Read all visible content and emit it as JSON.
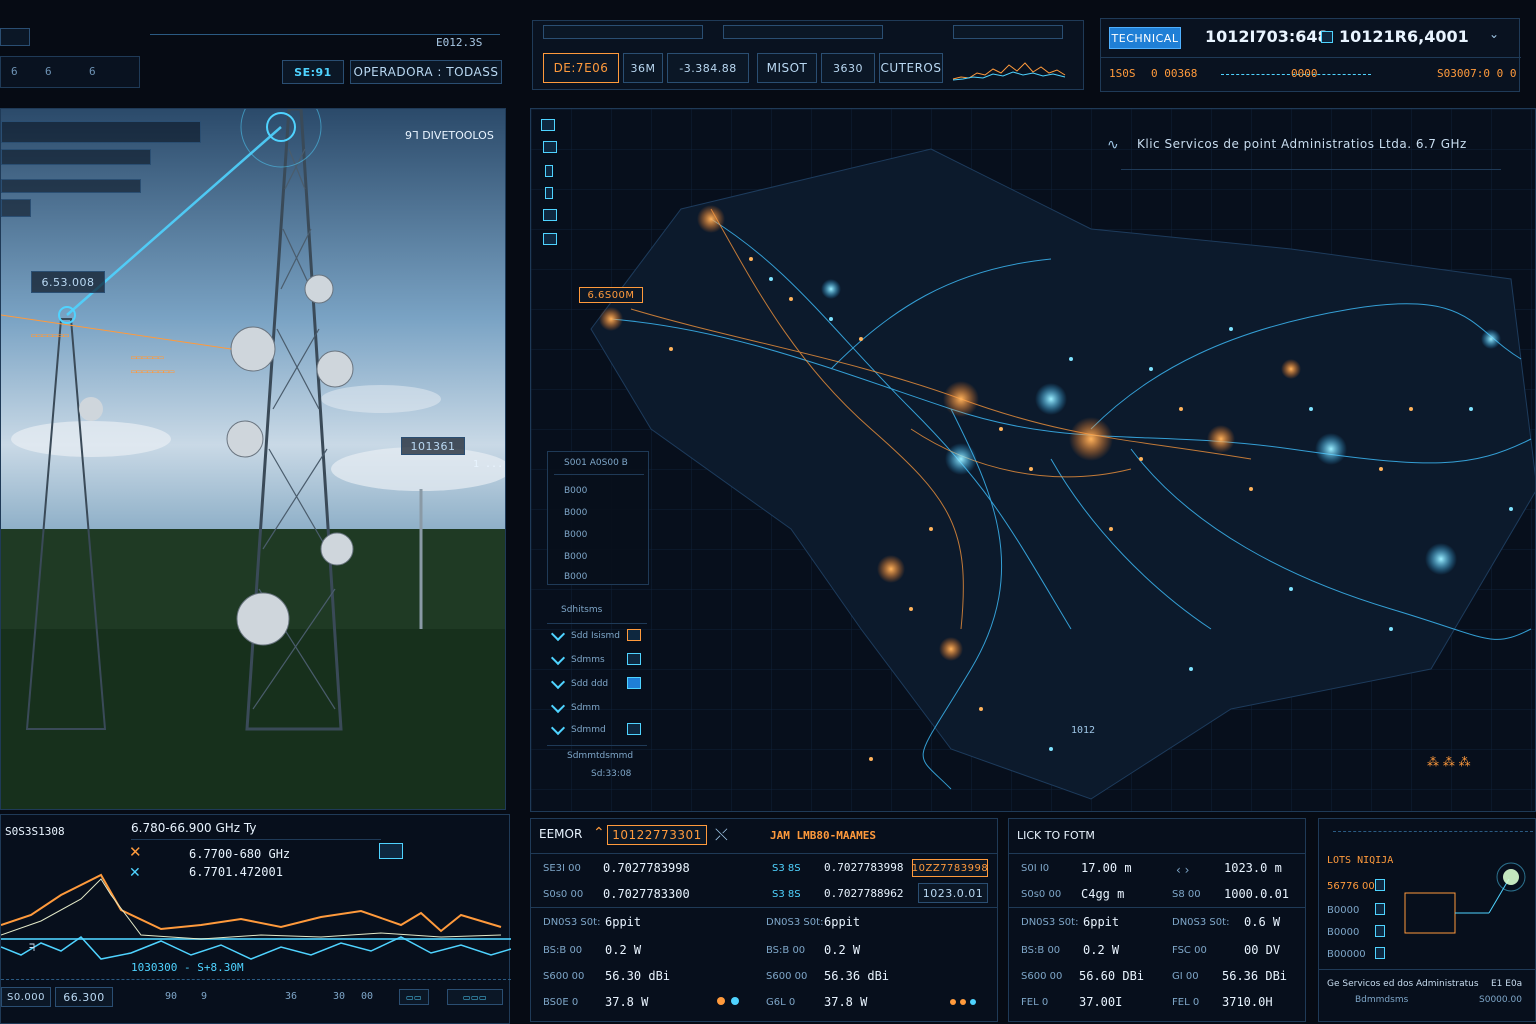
{
  "top_left": {
    "badge": "",
    "value_a": "6",
    "value_b": "6",
    "value_c": "6",
    "readout": "E012.3S",
    "selector_tag": "SE:91",
    "selector_label": "OPERADORA : TODASS"
  },
  "top_center": {
    "tab1": "",
    "tab2": "",
    "tab3": "",
    "alarm_label": "DE:7E06",
    "alarm_code": "36M",
    "alarm_value": "-3.384.88",
    "misc_label": "MISOT",
    "misc_value": "3630",
    "filter_label": "CUTEROS"
  },
  "top_right": {
    "mode_label": "TECHNICAL",
    "id_primary": "1012I703:648",
    "id_secondary": "10121R6,4001",
    "meta_a": "1S0S",
    "meta_b": "0 00368",
    "meta_c": "0000",
    "meta_d": "S03007:0 0 0"
  },
  "tower_view": {
    "header": "9ᒣ  DIVETOOLOS",
    "tag_main": "6.53.008",
    "tag_right": "101361",
    "tag_far": "1 ..."
  },
  "map": {
    "title": "Klic Servicos de point Administratios Ltda. 6.7 GHz",
    "site_label": "6.6S00M",
    "tag_low": "1012",
    "legend": {
      "title": "S001 A0S00 B",
      "rows": [
        "B000",
        "B000",
        "B000",
        "B000",
        "B000"
      ]
    },
    "checklist_title": "Sdhitsms",
    "checklist": [
      "Sdd Isismd",
      "Sdmms",
      "Sdd ddd",
      "Sdmm",
      "Sdmmd"
    ],
    "subtitle_a": "Sdmmtdsmmd",
    "subtitle_b": "Sd:33:08"
  },
  "spectrum": {
    "band_header": "6.780-66.900 GHz Ty",
    "left_id": "S0S3S1308",
    "range_1": "6.7700-680 GHz",
    "range_2": "6.7701.472001",
    "bottom_readout": "1030300 - S+8.30M",
    "footer_left": "S0.000",
    "footer_value": "66.300",
    "axis": [
      "90",
      "9",
      "36",
      "30",
      "00"
    ]
  },
  "link_panel_1": {
    "title": "EEMOR",
    "id": "10122773301",
    "rows": [
      {
        "label": "SE3I 00",
        "value": "0.7027783998"
      },
      {
        "label": "S0s0 00",
        "value": "0.7027783300"
      },
      {
        "label": "DN0S3 S0t:",
        "value": "6ppit"
      },
      {
        "label": "BS:B 00",
        "value": "0.2 W"
      },
      {
        "label": "S600 00",
        "value": "56.30 dBi"
      },
      {
        "label": "BS0E 0",
        "value": "37.8 W"
      }
    ]
  },
  "link_panel_2": {
    "title": "JAM LMB80-MAAMES",
    "rows": [
      {
        "label": "S3 8S",
        "value": "0.7027783998"
      },
      {
        "label": "S3 8S",
        "value": "0.7027788962"
      },
      {
        "label": "DN0S3 S0t:",
        "value": "6ppit"
      },
      {
        "label": "BS:B 00",
        "value": "0.2 W"
      },
      {
        "label": "S600 00",
        "value": "56.36 dBi"
      },
      {
        "label": "G6L 0",
        "value": "37.8 W"
      }
    ],
    "highlight_a": "10ZZ7783998",
    "highlight_b": "1023.0.01"
  },
  "link_panel_3": {
    "title": "LICK TO FOTM",
    "rows": [
      {
        "label": "S0I I0",
        "value": "17.00 m"
      },
      {
        "label": "S0s0 00",
        "value": "C4gg m"
      },
      {
        "label": "DN0S3 S0t:",
        "value": "6ppit"
      },
      {
        "label": "BS:B 00",
        "value": "0.2 W"
      },
      {
        "label": "S600 00",
        "value": "56.60 DBi"
      },
      {
        "label": "FEL 0",
        "value": "37.00I"
      }
    ]
  },
  "link_panel_4": {
    "rows": [
      {
        "label": "‹ ›",
        "value": "1023.0 m"
      },
      {
        "label": "S8 00",
        "value": "1000.0.01"
      },
      {
        "label": "DN0S3 S0t:",
        "value": "0.6 W"
      },
      {
        "label": "FSC 00",
        "value": "00 DV"
      },
      {
        "label": "GI 00",
        "value": "56.36 DBi"
      },
      {
        "label": "FEL 0",
        "value": "3710.0H"
      }
    ]
  },
  "link_panel_5": {
    "title": "LOTS NIQIJA",
    "rows": [
      "56776 00",
      "B0000",
      "B0000",
      "B00000"
    ],
    "footer": "Ge Servicos ed dos Administratus",
    "footer_b": "E1 E0a",
    "footer_c": "Bdmmdsms",
    "footer_d": "S0000.00"
  },
  "colors": {
    "accent": "#4fd3ff",
    "warning": "#ff9a3c",
    "panel_border": "#1f3a57",
    "button_active": "#1f7fd6"
  }
}
